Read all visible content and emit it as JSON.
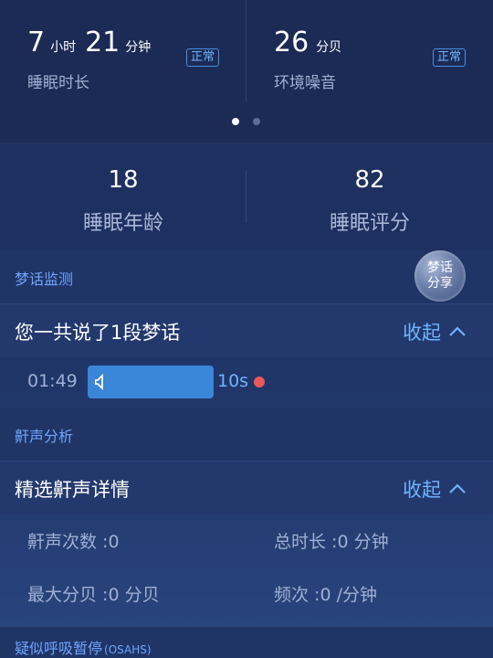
{
  "summary": {
    "sleep_hours": "7",
    "hours_unit": "小时",
    "sleep_minutes": "21",
    "minutes_unit": "分钟",
    "sleep_label": "睡眠时长",
    "sleep_badge": "正常",
    "noise_value": "26",
    "noise_unit": "分贝",
    "noise_label": "环境噪音",
    "noise_badge": "正常"
  },
  "pager": {
    "active_index": 0,
    "count": 2
  },
  "scores": {
    "age_value": "18",
    "age_label": "睡眠年龄",
    "score_value": "82",
    "score_label": "睡眠评分"
  },
  "dream": {
    "section_title": "梦话监测",
    "share_line1": "梦话",
    "share_line2": "分享",
    "summary_text": "您一共说了1段梦话",
    "collapse_label": "收起",
    "clip_time": "01:49",
    "clip_duration": "10s"
  },
  "snore": {
    "section_title": "鼾声分析",
    "detail_title": "精选鼾声详情",
    "collapse_label": "收起",
    "count_label": "鼾声次数 :0",
    "total_label": "总时长 :0 分钟",
    "max_db_label": "最大分贝 :0 分贝",
    "freq_label": "频次 :0 /分钟"
  },
  "osahs": {
    "section_title_main": "疑似呼吸暂停",
    "section_title_suffix": "(OSAHS)"
  },
  "colors": {
    "accent": "#6fb4ff",
    "record": "#e9585b",
    "bar": "#3a86d8"
  }
}
